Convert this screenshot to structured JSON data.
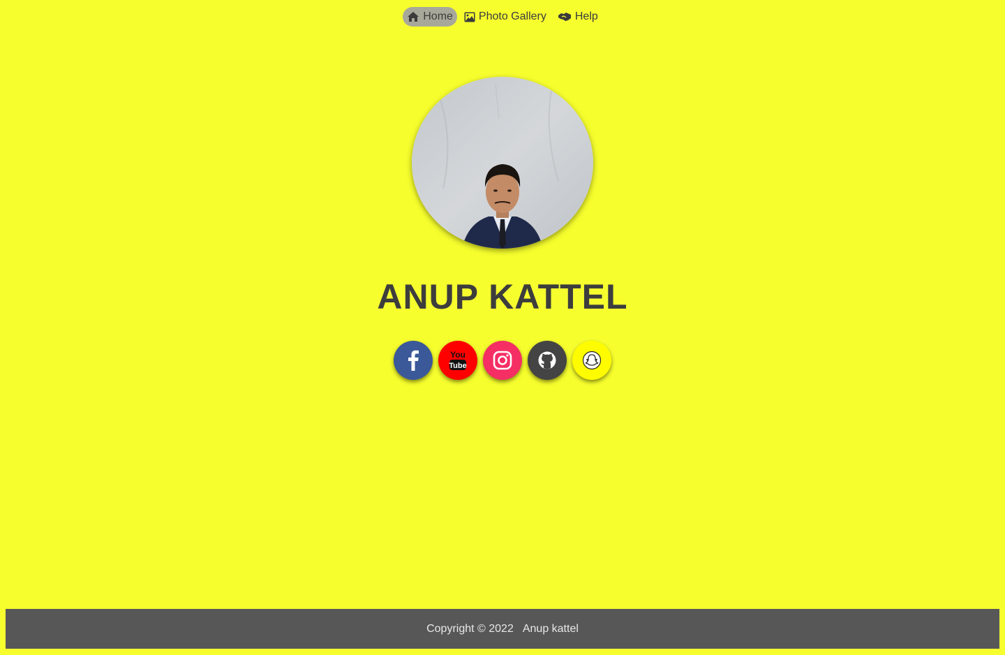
{
  "nav": {
    "items": [
      {
        "label": "Home",
        "icon": "home-icon",
        "active": true
      },
      {
        "label": "Photo Gallery",
        "icon": "image-icon",
        "active": false
      },
      {
        "label": "Help",
        "icon": "handshake-icon",
        "active": false
      }
    ]
  },
  "profile": {
    "name": "ANUP KATTEL",
    "avatar_alt": "profile-photo"
  },
  "social": [
    {
      "name": "facebook",
      "icon": "facebook-icon",
      "color": "#3b5998"
    },
    {
      "name": "youtube",
      "icon": "youtube-icon",
      "color": "#ff0000"
    },
    {
      "name": "instagram",
      "icon": "instagram-icon",
      "color": "#f52e64"
    },
    {
      "name": "github",
      "icon": "github-icon",
      "color": "#444444"
    },
    {
      "name": "snapchat",
      "icon": "snapchat-icon",
      "color": "#fffc00"
    }
  ],
  "footer": {
    "copyright": "Copyright © 2022",
    "author": "Anup kattel"
  },
  "colors": {
    "page_bg": "#f6fe2e",
    "footer_bg": "#575757",
    "nav_active_bg": "#a8a89a"
  }
}
